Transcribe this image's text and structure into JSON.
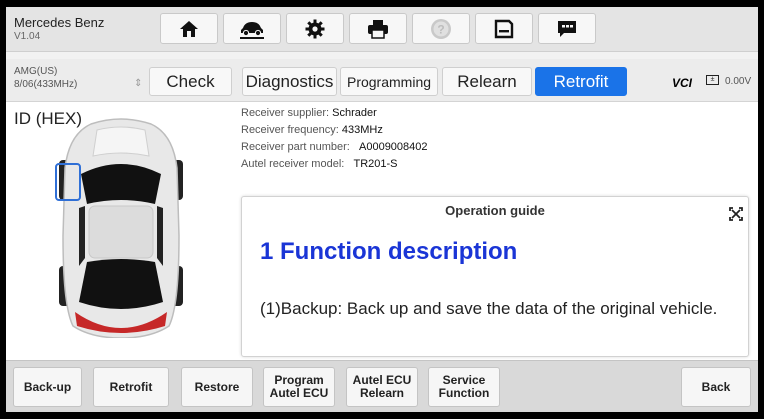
{
  "header": {
    "vehicle_name": "Mercedes Benz",
    "version": "V1.04",
    "icons": [
      "home-icon",
      "vehicle-lift-icon",
      "gear-icon",
      "printer-icon",
      "help-icon",
      "save-icon",
      "message-icon"
    ]
  },
  "tabbar": {
    "protocol_line1": "AMG(US)",
    "protocol_line2": "8/06(433MHz)",
    "tabs": [
      "Check",
      "Diagnostics",
      "Programming",
      "Relearn",
      "Retrofit"
    ],
    "active_tab": "Retrofit",
    "vci_label": "VCI",
    "voltage": "0.00V"
  },
  "content": {
    "id_label": "ID (HEX)",
    "receiver": {
      "supplier_label": "Receiver supplier:",
      "supplier_value": "Schrader",
      "frequency_label": "Receiver frequency:",
      "frequency_value": "433MHz",
      "part_label": "Receiver part number:",
      "part_value": "A0009008402",
      "model_label": "Autel receiver model:",
      "model_value": "TR201-S"
    },
    "guide": {
      "title": "Operation guide",
      "heading": "1 Function description",
      "body": "(1)Backup: Back up and save the data of the original vehicle."
    }
  },
  "footer": {
    "backup": "Back-up",
    "retrofit": "Retrofit",
    "restore": "Restore",
    "program_ecu_1": "Program",
    "program_ecu_2": "Autel ECU",
    "relearn_ecu_1": "Autel ECU",
    "relearn_ecu_2": "Relearn",
    "service_1": "Service",
    "service_2": "Function",
    "back": "Back"
  },
  "colors": {
    "accent": "#1a73e8",
    "heading_blue": "#1a35d6",
    "selection_outline": "#2f6fd6"
  }
}
